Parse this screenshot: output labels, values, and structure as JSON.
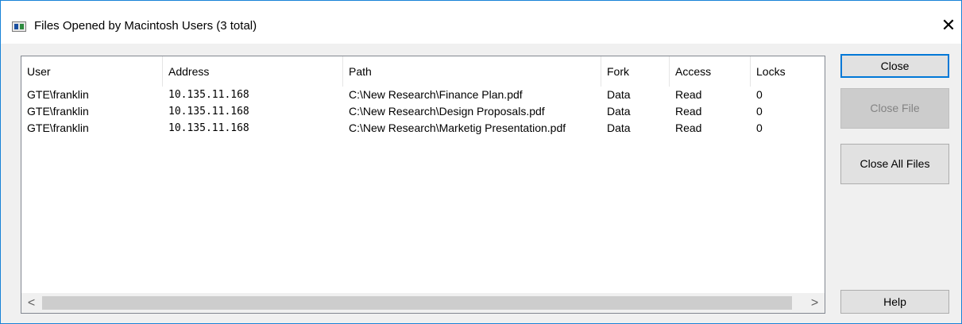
{
  "window": {
    "title": "Files Opened by Macintosh Users (3 total)",
    "icon": "app-window-icon",
    "close_glyph": "✕"
  },
  "table": {
    "columns": [
      "User",
      "Address",
      "Path",
      "Fork",
      "Access",
      "Locks"
    ],
    "rows": [
      {
        "user": "GTE\\franklin",
        "address": "10.135.11.168",
        "path": "C:\\New Research\\Finance Plan.pdf",
        "fork": "Data",
        "access": "Read",
        "locks": "0"
      },
      {
        "user": "GTE\\franklin",
        "address": "10.135.11.168",
        "path": "C:\\New Research\\Design Proposals.pdf",
        "fork": "Data",
        "access": "Read",
        "locks": "0"
      },
      {
        "user": "GTE\\franklin",
        "address": "10.135.11.168",
        "path": "C:\\New Research\\Marketig Presentation.pdf",
        "fork": "Data",
        "access": "Read",
        "locks": "0"
      }
    ]
  },
  "scrollbar": {
    "left_arrow": "<",
    "right_arrow": ">"
  },
  "buttons": {
    "close": "Close",
    "close_file": "Close File",
    "close_all_files": "Close All Files",
    "help": "Help"
  }
}
